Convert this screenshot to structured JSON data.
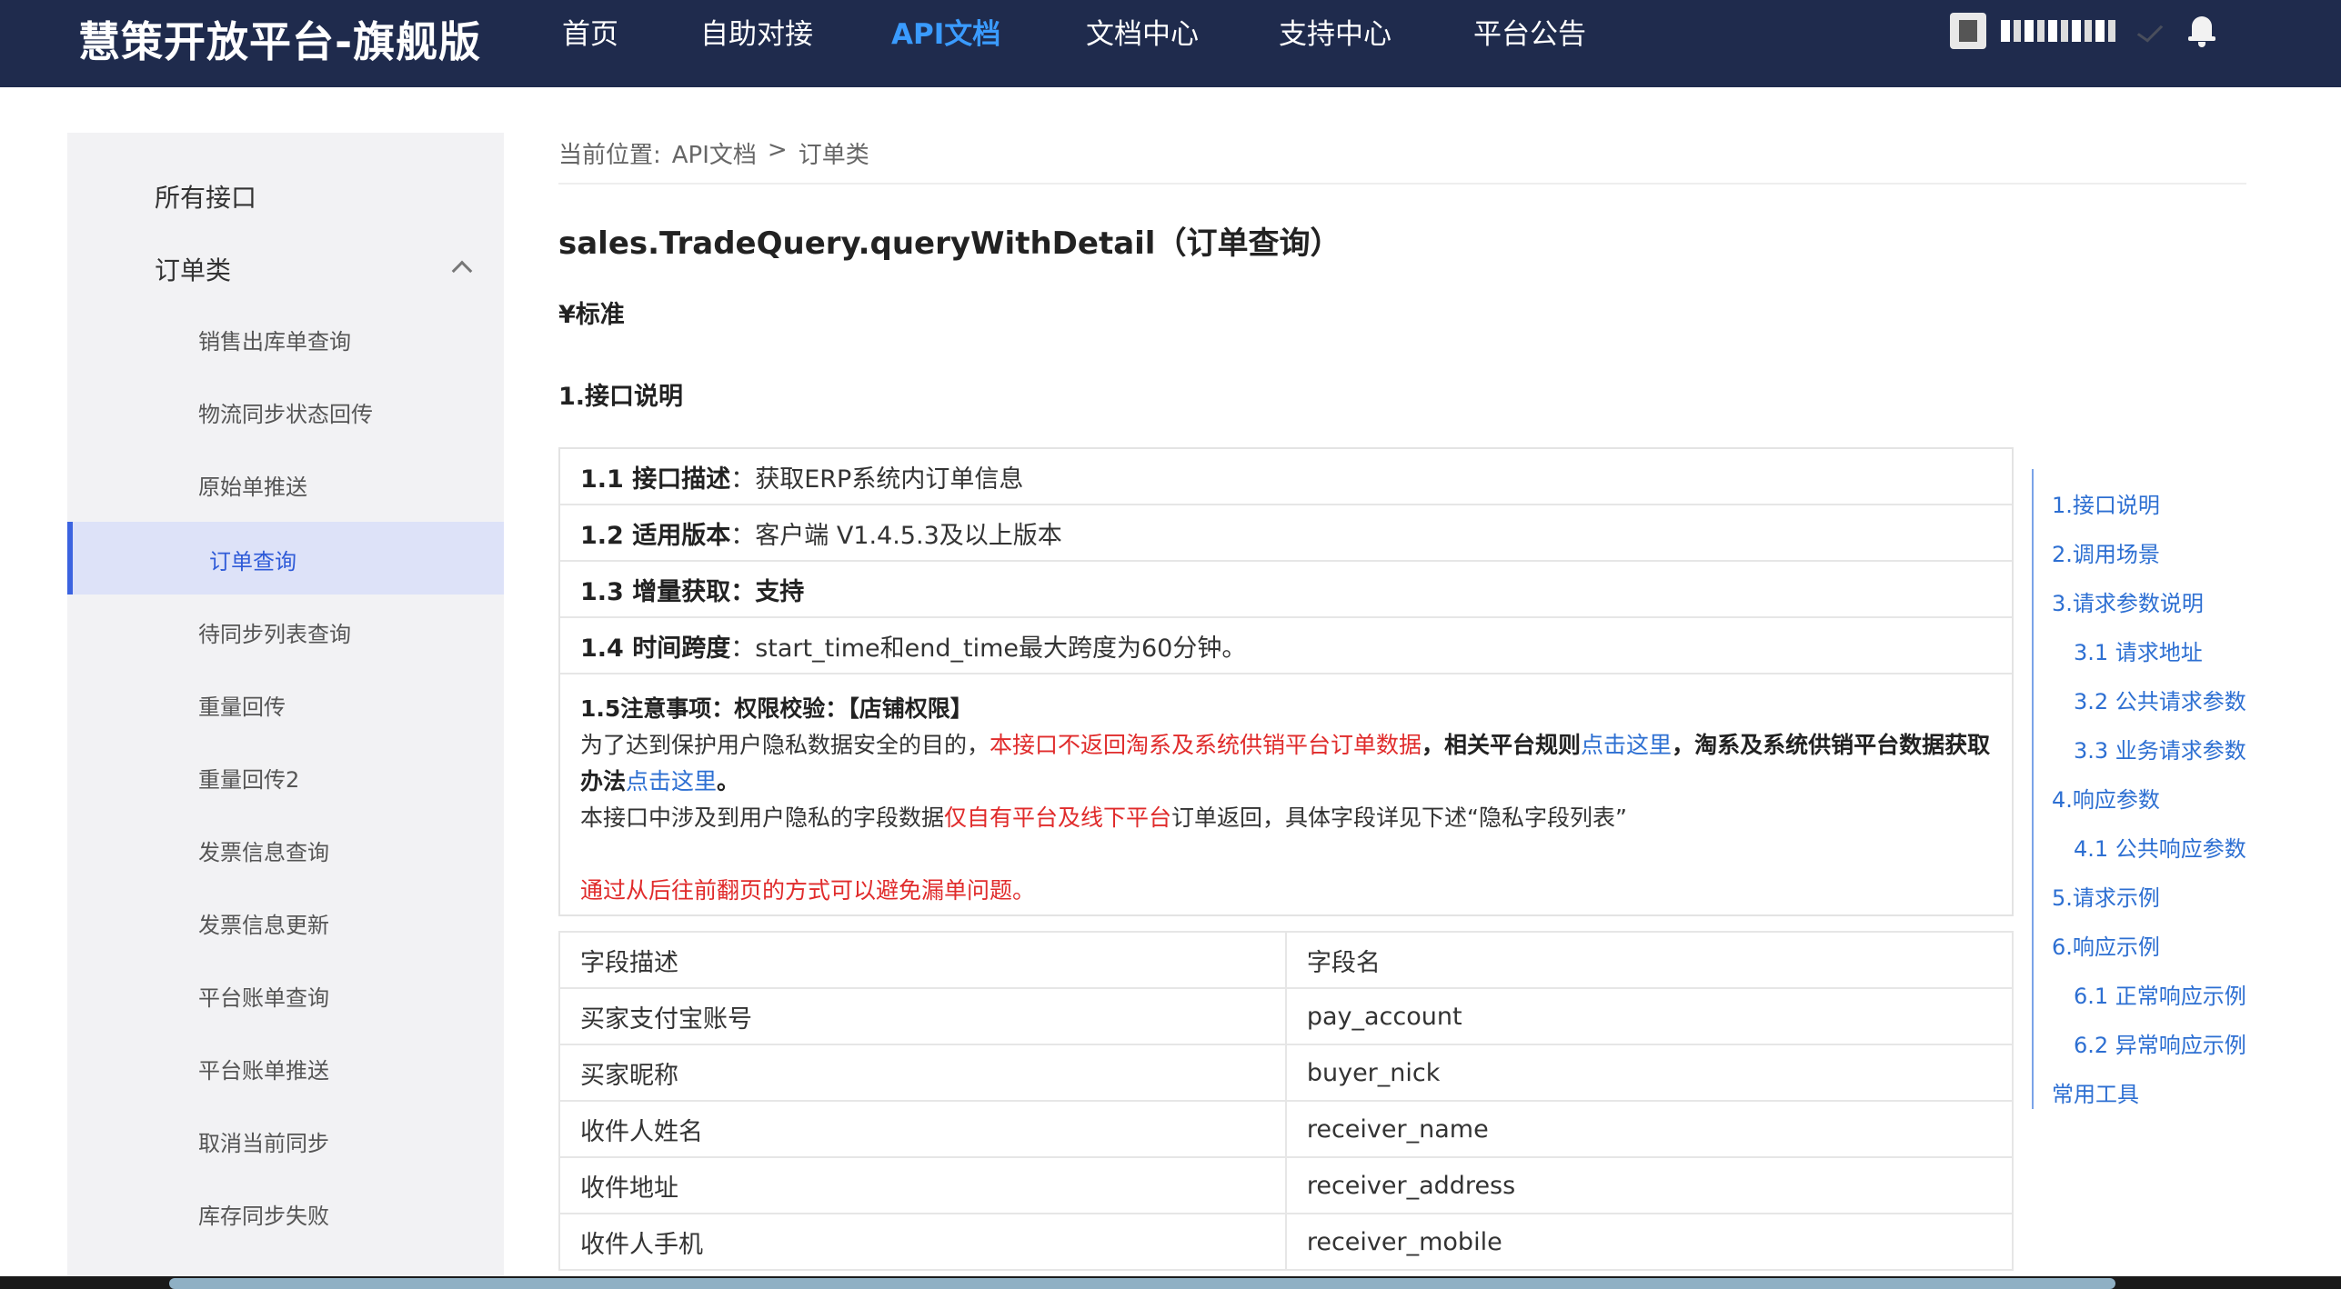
{
  "header": {
    "brand": "慧策开放平台-旗舰版",
    "nav": [
      "首页",
      "自助对接",
      "API文档",
      "文档中心",
      "支持中心",
      "平台公告"
    ],
    "active_nav": "API文档"
  },
  "sidebar": {
    "all": "所有接口",
    "category": "订单类",
    "items": [
      "销售出库单查询",
      "物流同步状态回传",
      "原始单推送",
      "订单查询",
      "待同步列表查询",
      "重量回传",
      "重量回传2",
      "发票信息查询",
      "发票信息更新",
      "平台账单查询",
      "平台账单推送",
      "取消当前同步",
      "库存同步失败"
    ],
    "active": "订单查询"
  },
  "breadcrumb": {
    "label": "当前位置:",
    "path1": "API文档",
    "sep": ">",
    "path2": "订单类"
  },
  "page": {
    "title": "sales.TradeQuery.queryWithDetail（订单查询）",
    "standard": "¥标准",
    "section1": "1.接口说明"
  },
  "info": {
    "r1_label": "1.1 接口描述",
    "r1_value": "：获取ERP系统内订单信息",
    "r2_label": "1.2 适用版本",
    "r2_value": "：客户端 V1.4.5.3及以上版本",
    "r3_label": "1.3 增量获取",
    "r3_value": "：支持",
    "r4_label": "1.4 时间跨度",
    "r4_value": "：start_time和end_time最大跨度为60分钟。",
    "note_title": "1.5注意事项：权限校验：【店铺权限】",
    "note_p1_a": "为了达到保护用户隐私数据安全的目的，",
    "note_p1_red": "本接口不返回淘系及系统供销平台订单数据",
    "note_p1_b": "，相关平台规则",
    "note_p1_link": "点击这里",
    "note_p1_c": "，淘系及系统供销平台数据获取办法",
    "note_p1_link2": "点击这里",
    "note_p1_d": "。",
    "note_p2_a": "本接口中涉及到用户隐私的字段数据",
    "note_p2_red": "仅自有平台及线下平台",
    "note_p2_b": "订单返回，具体字段详见下述“隐私字段列表”",
    "note_p3": "通过从后往前翻页的方式可以避免漏单问题。"
  },
  "fields": {
    "headers": [
      "字段描述",
      "字段名"
    ],
    "rows": [
      [
        "买家支付宝账号",
        "pay_account"
      ],
      [
        "买家昵称",
        "buyer_nick"
      ],
      [
        "收件人姓名",
        "receiver_name"
      ],
      [
        "收件地址",
        "receiver_address"
      ],
      [
        "收件人手机",
        "receiver_mobile"
      ]
    ]
  },
  "toc": [
    "1.接口说明",
    "2.调用场景",
    "3.请求参数说明",
    "3.1 请求地址",
    "3.2 公共请求参数",
    "3.3 业务请求参数",
    "4.响应参数",
    "4.1 公共响应参数",
    "5.请求示例",
    "6.响应示例",
    "6.1 正常响应示例",
    "6.2 异常响应示例",
    "常用工具"
  ]
}
